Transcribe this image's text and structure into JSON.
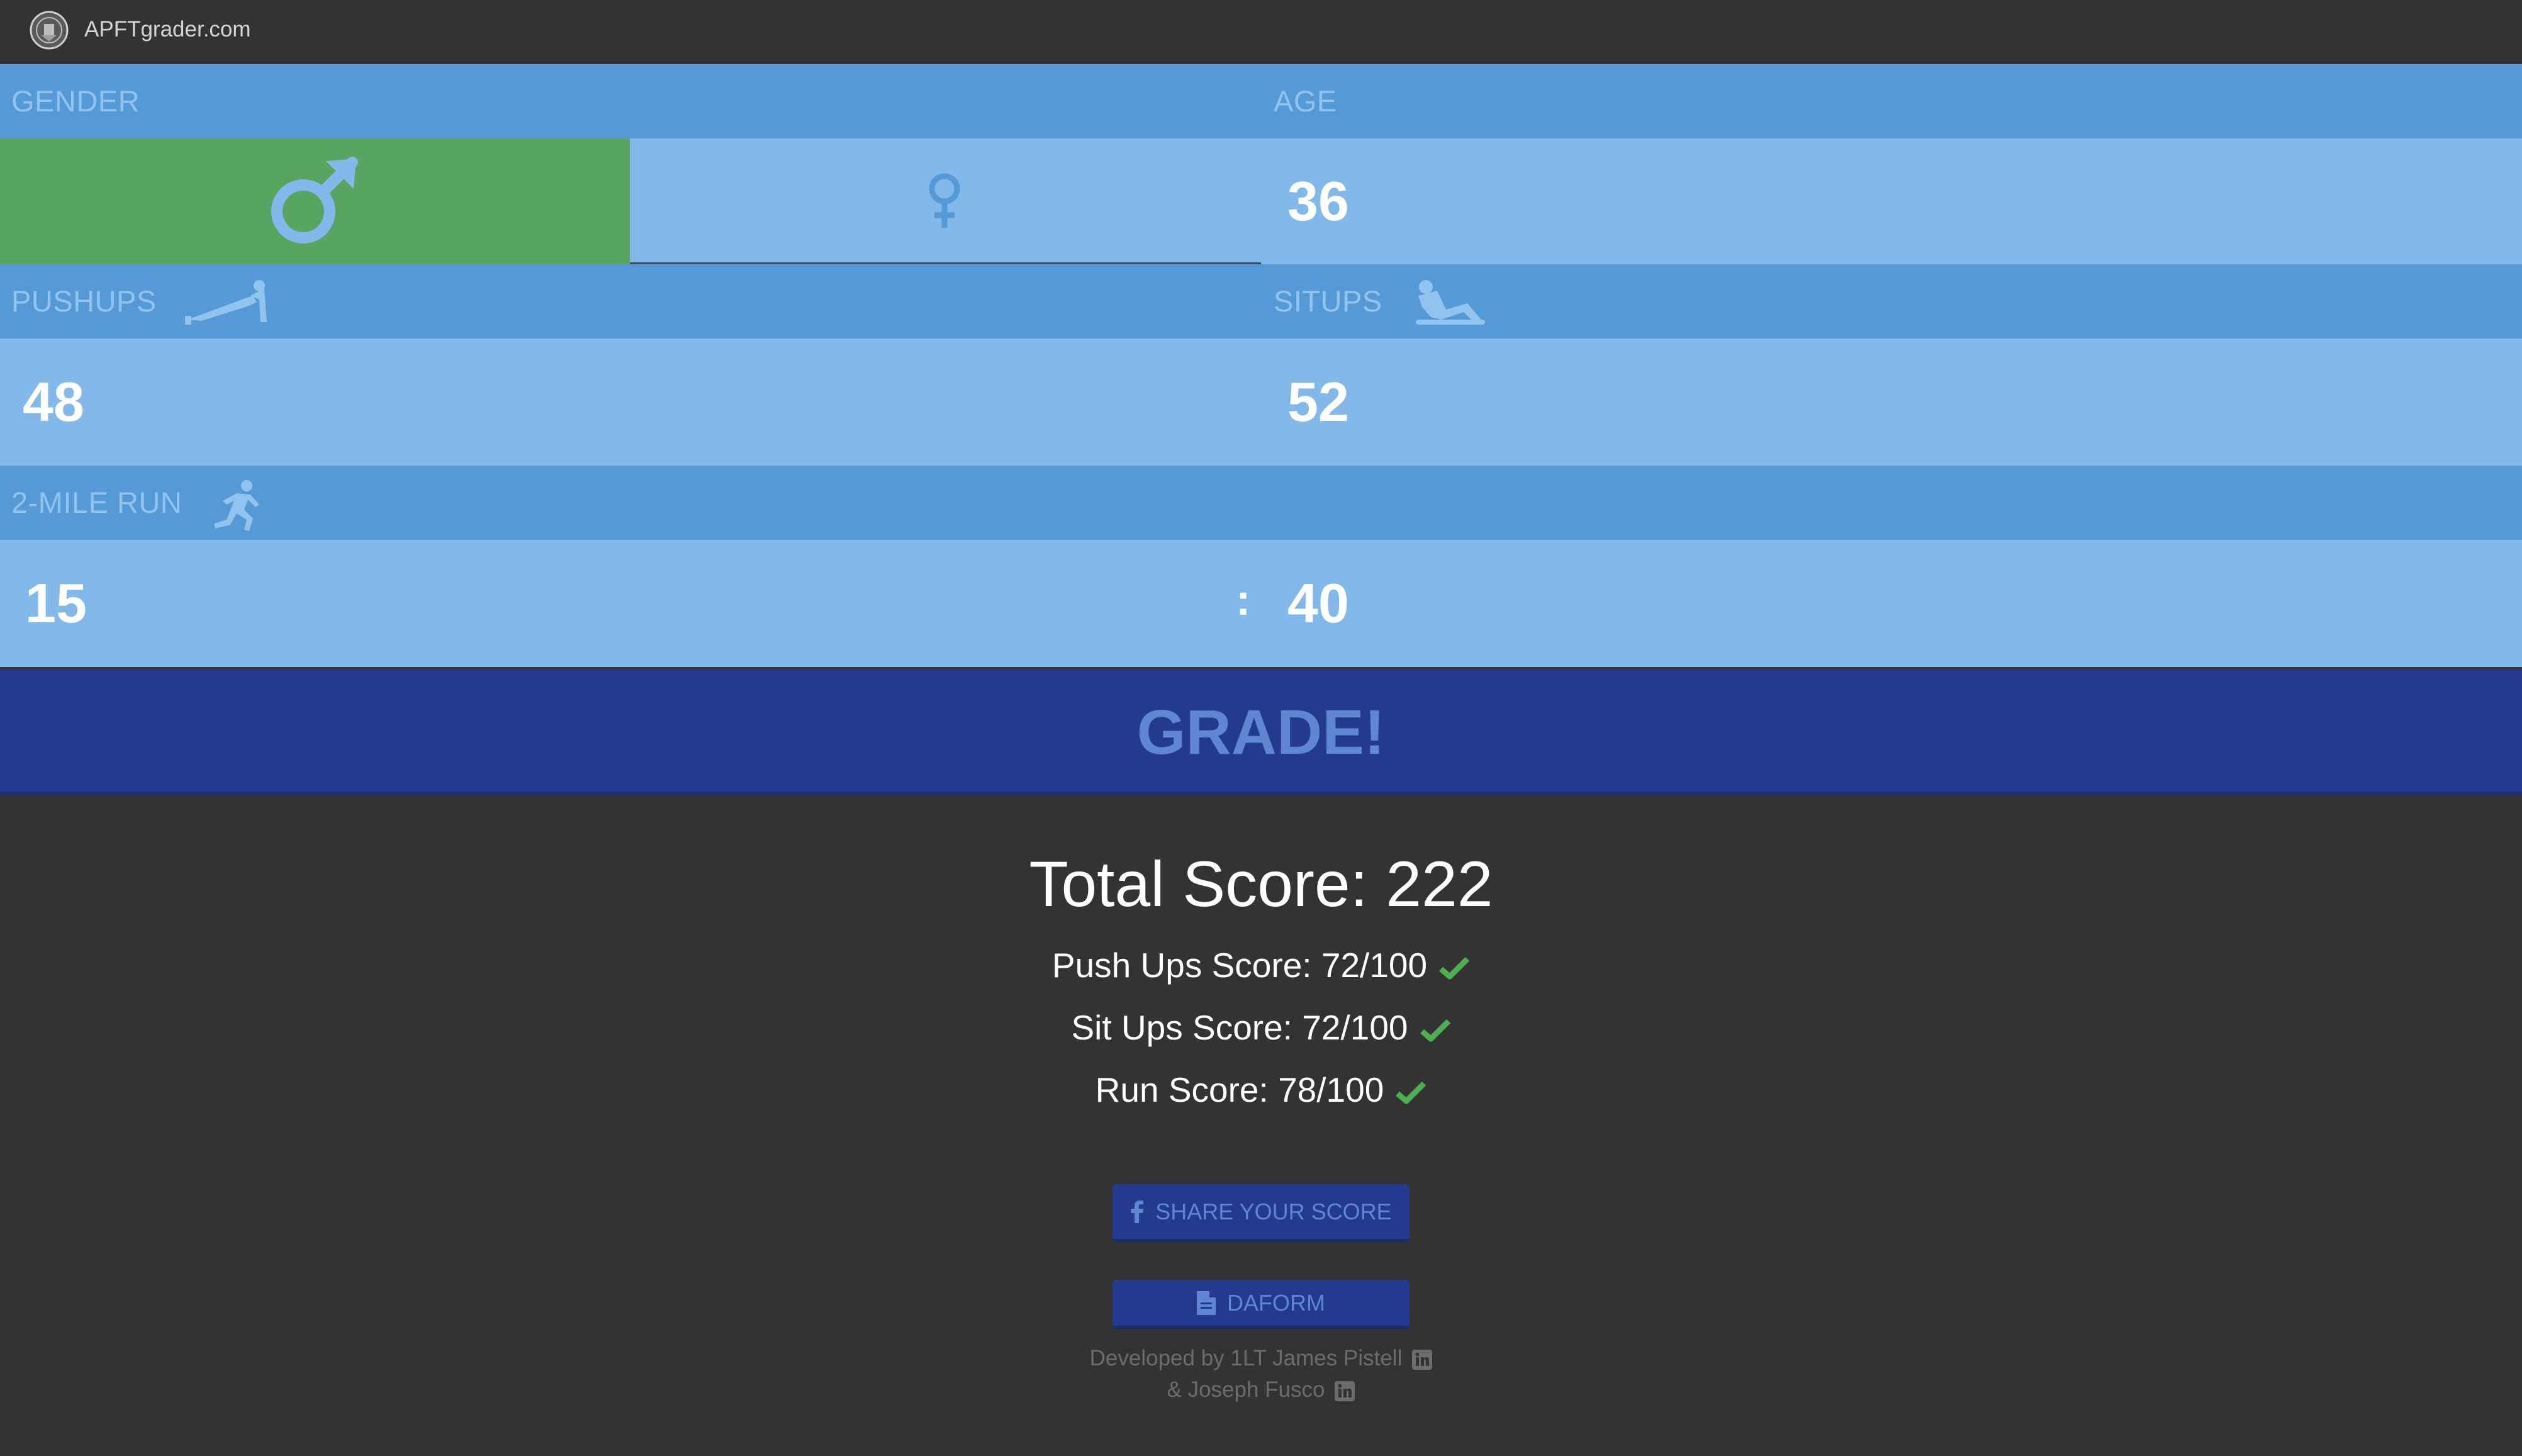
{
  "header": {
    "site_name": "APFTgrader.com"
  },
  "labels": {
    "gender": "GENDER",
    "age": "AGE",
    "pushups": "PUSHUPS",
    "situps": "SITUPS",
    "run": "2-MILE RUN"
  },
  "inputs": {
    "age": "36",
    "pushups": "48",
    "situps": "52",
    "run_minutes": "15",
    "run_separator": ":",
    "run_seconds": "40"
  },
  "grade_button": "GRADE!",
  "results": {
    "total": "Total Score: 222",
    "pushups": "Push Ups Score: 72/100",
    "situps": "Sit Ups Score: 72/100",
    "run": "Run Score: 78/100"
  },
  "buttons": {
    "share": "SHARE YOUR SCORE",
    "daform": "DAFORM"
  },
  "credits": {
    "line1": "Developed by 1LT James Pistell",
    "line2": "& Joseph Fusco"
  },
  "colors": {
    "selected_gender": "#58a562",
    "section_bar": "#5599d6",
    "input_row": "#82b8ea",
    "grade_button": "#233a8e",
    "check": "#4caf50",
    "background": "#333333"
  },
  "icons": {
    "logo": "army-seal-icon",
    "male": "male-symbol-icon",
    "female": "female-symbol-icon",
    "pushups": "pushup-figure-icon",
    "situps": "situp-figure-icon",
    "run": "runner-figure-icon",
    "check": "check-icon",
    "facebook": "facebook-icon",
    "document": "document-icon",
    "linkedin": "linkedin-icon"
  }
}
